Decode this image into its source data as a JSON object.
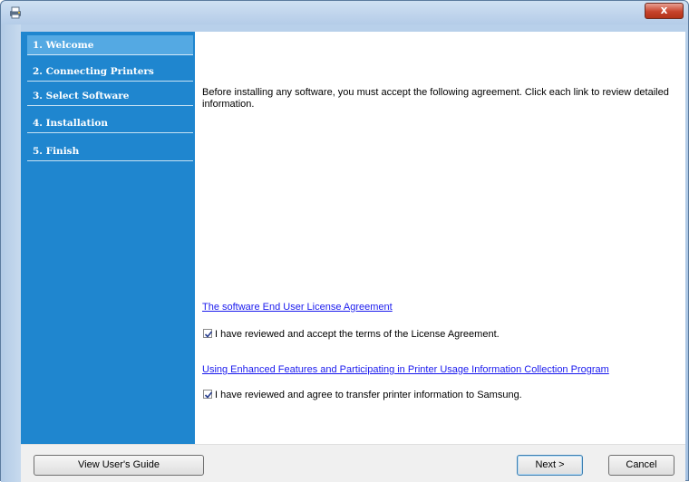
{
  "window": {
    "close_label": "x"
  },
  "sidebar": {
    "steps": [
      {
        "label": "1. Welcome",
        "active": true
      },
      {
        "label": "2. Connecting Printers",
        "active": false
      },
      {
        "label": "3. Select Software",
        "active": false
      },
      {
        "label": "4. Installation",
        "active": false
      },
      {
        "label": "5. Finish",
        "active": false
      }
    ]
  },
  "content": {
    "intro": "Before installing any software, you must accept the following agreement. Click each link to review detailed information.",
    "eula_link": "The software End User License Agreement",
    "eula_checkbox": {
      "label": "I have reviewed and accept the terms of the License Agreement.",
      "checked": true
    },
    "usage_link": "Using Enhanced Features and Participating in Printer Usage Information Collection Program",
    "usage_checkbox": {
      "label": "I have reviewed and agree to transfer printer information to Samsung.",
      "checked": true
    }
  },
  "footer": {
    "guide_button": "View User's Guide",
    "next_button": "Next >",
    "cancel_button": "Cancel"
  },
  "colors": {
    "sidebar": "#1f86cf",
    "active_step": "#54a9e3",
    "link": "#1a1aee"
  },
  "icons": {
    "app": "printer-installer-icon",
    "close": "close-icon",
    "check": "checkmark-icon"
  }
}
